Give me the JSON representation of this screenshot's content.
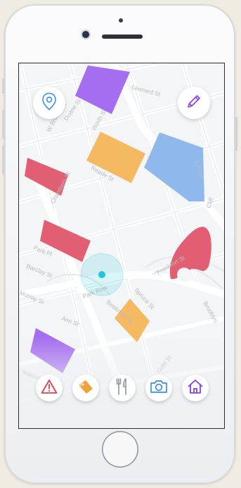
{
  "map": {
    "streets": [
      "Leonard St",
      "W Broadway",
      "Duane St",
      "Reade St",
      "Chambers St",
      "Park Pl",
      "Barclay St",
      "Murray St",
      "Ann St",
      "Spruce St",
      "Park Row",
      "Beekman St",
      "Gold St",
      "Frankfort St",
      "Brooklyn",
      "Cliff",
      "Maiden",
      "Centre",
      "Worth St"
    ],
    "zone_colors": {
      "purple": "#a56df0",
      "orange": "#f4b961",
      "blue": "#8fb8ec",
      "red": "#e25f73",
      "location": "#22c6d8"
    }
  },
  "buttons": {
    "location": {
      "icon": "map-pin-icon"
    },
    "edit": {
      "icon": "pencil-icon"
    }
  },
  "toolbar": [
    {
      "icon": "warning-icon",
      "color": "#e23c48"
    },
    {
      "icon": "tag-icon",
      "color": "#f2a23a"
    },
    {
      "icon": "fork-knife-icon",
      "color": "#8e949c"
    },
    {
      "icon": "camera-icon",
      "color": "#3a8fe0"
    },
    {
      "icon": "home-icon",
      "color": "#8a3ee8"
    }
  ]
}
